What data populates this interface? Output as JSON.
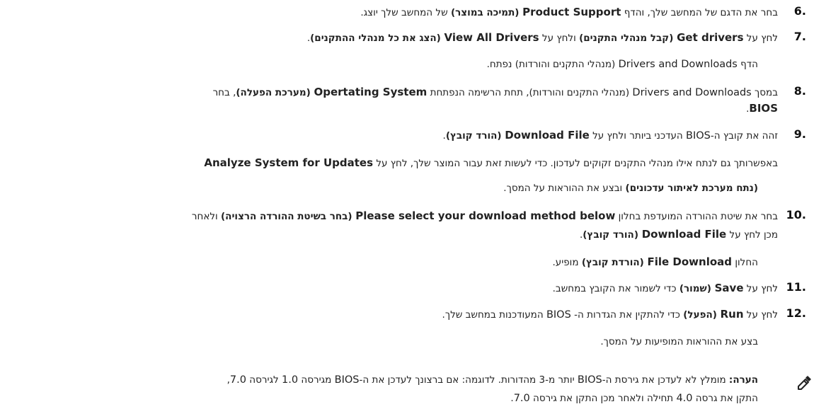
{
  "steps": [
    {
      "num": ".6",
      "parts": [
        "בחר את הדגם של המחשב שלך, והדף ",
        "Product Support",
        " (תמיכה במוצר)",
        " של המחשב שלך יוצג."
      ]
    },
    {
      "num": ".7",
      "parts": [
        "לחץ על ",
        "Get drivers",
        " (קבל מנהלי התקנים)",
        " ולחץ על ",
        "View All Drivers",
        " (הצג את כל מנהלי ההתקנים)",
        "."
      ],
      "sub": [
        "הדף ",
        "Drivers and Downloads",
        " (מנהלי התקנים והורדות) נפתח."
      ]
    },
    {
      "num": ".8",
      "parts": [
        "במסך ",
        "Drivers and Downloads",
        " (מנהלי התקנים והורדות), תחת הרשימה הנפתחת ",
        "Opertating System",
        " (מערכת הפעלה)",
        ", בחר"
      ],
      "line2": [
        "BIOS",
        "."
      ]
    },
    {
      "num": ".9",
      "parts": [
        "זהה את קובץ ה-",
        "BIOS",
        " העדכני ביותר ולחץ על ",
        "Download File",
        " (הורד קובץ)",
        "."
      ]
    },
    {
      "analyze_line1": [
        "באפשרותך גם לנתח אילו מנהלי התקנים זקוקים לעדכון. כדי לעשות זאת עבור המוצר שלך, לחץ על ",
        "Analyze System for Updates"
      ],
      "analyze_line2": [
        "(נתח מערכת לאיתור עדכונים)",
        " ובצע את ההוראות על המסך."
      ]
    },
    {
      "num": ".10",
      "parts": [
        "בחר את שיטת ההורדה המועדפת בחלון ",
        "Please select your download method below",
        " (בחר בשיטת ההורדה הרצויה)",
        " ולאחר"
      ],
      "line2": [
        "מכן לחץ על ",
        "Download File",
        " (הורד קובץ)",
        "."
      ],
      "sub": [
        "החלון ",
        "File Download",
        " (הורדת קובץ)",
        " מופיע."
      ]
    },
    {
      "num": ".11",
      "parts": [
        "לחץ על ",
        "Save",
        " (שמור)",
        " כדי לשמור את הקובץ במחשב."
      ]
    },
    {
      "num": ".12",
      "parts": [
        "לחץ על ",
        "Run",
        " (הפעל)",
        " כדי להתקין את הגדרות ה- ",
        "BIOS",
        " המעודכנות במחשב שלך."
      ],
      "sub": [
        "בצע את ההוראות המופיעות על המסך."
      ]
    }
  ],
  "note": {
    "icon": "note-pencil-icon",
    "label": "הערה:",
    "line1": [
      " מומלץ לא לעדכן את גירסת ה-",
      "BIOS",
      " יותר מ-3 מהדורות. לדוגמה: אם ברצונך לעדכן את ה-",
      "BIOS",
      " מגירסה ",
      "1.0",
      " לגירסה ",
      "7.0",
      ","
    ],
    "line2": [
      "התקן את גרסה ",
      "4.0",
      " תחילה ולאחר מכן התקן את גירסה ",
      "7.0",
      "."
    ]
  }
}
